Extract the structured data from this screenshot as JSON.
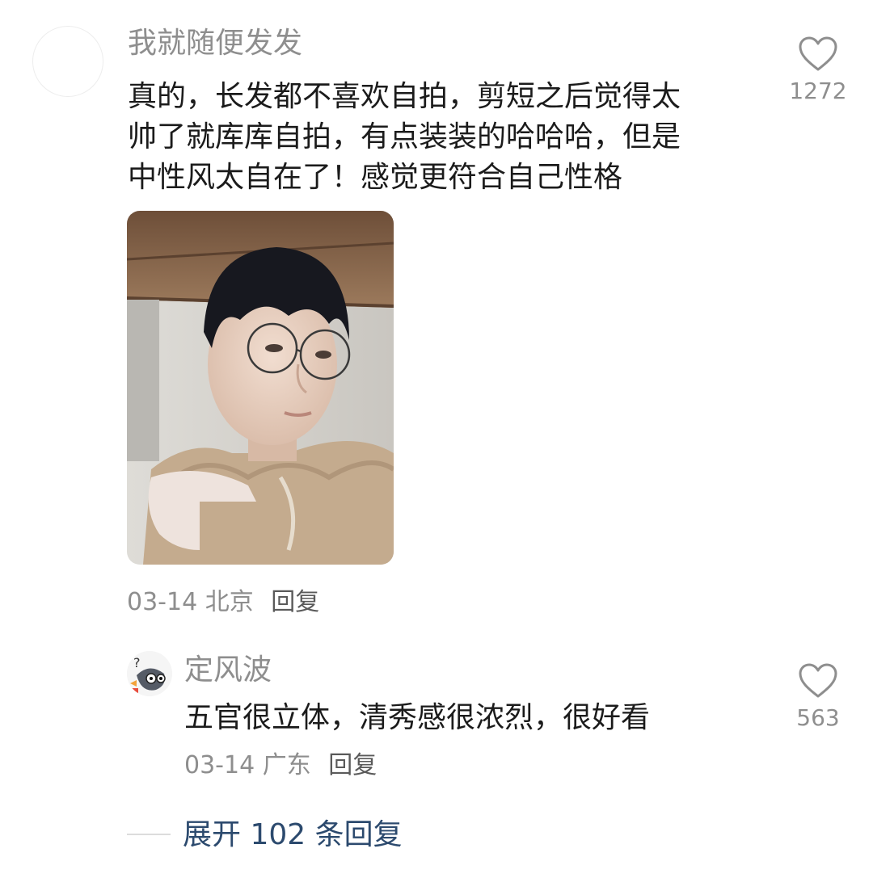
{
  "comment": {
    "username": "我就随便发发",
    "text_lines": [
      "真的，长发都不喜欢自拍，剪短之后觉得太",
      "帅了就库库自拍，有点装装的哈哈哈，但是",
      "中性风太自在了！感觉更符合自己性格"
    ],
    "like_count": "1272",
    "date": "03-14",
    "location": "北京",
    "reply_label": "回复"
  },
  "reply": {
    "username": "定风波",
    "text": "五官很立体，清秀感很浓烈，很好看",
    "like_count": "563",
    "date": "03-14",
    "location": "广东",
    "reply_label": "回复"
  },
  "expand_replies_label": "展开 102 条回复",
  "icons": {
    "like": "heart-outline-icon",
    "avatar_main": "avatar-placeholder",
    "avatar_sub": "bird-cartoon-avatar"
  },
  "colors": {
    "text": "#1b1b1b",
    "muted": "#8e8e8e",
    "link": "#2c4a6e"
  }
}
